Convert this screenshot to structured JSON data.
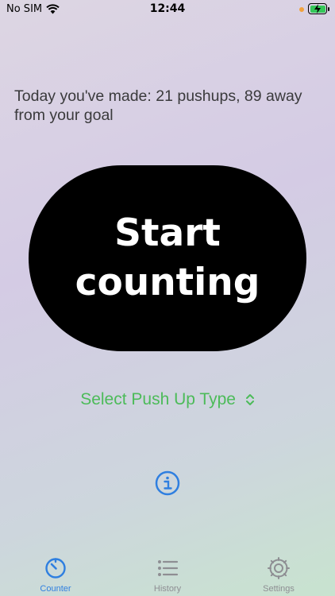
{
  "status_bar": {
    "carrier": "No SIM",
    "time": "12:44"
  },
  "main": {
    "summary": "Today you've made: 21 pushups, 89 away from your goal",
    "start_button_label": "Start counting",
    "push_up_type_label": "Select Push Up Type"
  },
  "tab_bar": {
    "tabs": [
      {
        "label": "Counter",
        "icon": "timer-icon",
        "active": true
      },
      {
        "label": "History",
        "icon": "list-icon",
        "active": false
      },
      {
        "label": "Settings",
        "icon": "gear-icon",
        "active": false
      }
    ]
  },
  "colors": {
    "accent_blue": "#2f7fe0",
    "accent_green": "#4cbb59",
    "button_black": "#000000"
  }
}
